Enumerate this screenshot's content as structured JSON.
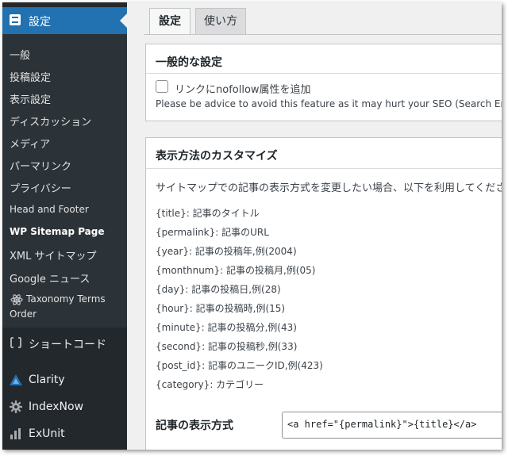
{
  "sidebar": {
    "current": {
      "label": "設定",
      "icon": "settings-icon"
    },
    "items": [
      {
        "label": "一般"
      },
      {
        "label": "投稿設定"
      },
      {
        "label": "表示設定"
      },
      {
        "label": "ディスカッション"
      },
      {
        "label": "メディア"
      },
      {
        "label": "パーマリンク"
      },
      {
        "label": "プライバシー"
      },
      {
        "label": "Head and Footer"
      },
      {
        "label": "WP Sitemap Page"
      },
      {
        "label": "XML サイトマップ"
      },
      {
        "label": "Google ニュース"
      },
      {
        "label": "Taxonomy Terms",
        "label2": "Order"
      }
    ],
    "menus": [
      {
        "label": "ショートコード",
        "icon": "shortcode-icon"
      },
      {
        "label": "Clarity",
        "icon": "clarity-icon"
      },
      {
        "label": "IndexNow",
        "icon": "indexnow-icon"
      },
      {
        "label": "ExUnit",
        "icon": "exunit-icon"
      }
    ]
  },
  "tabs": [
    {
      "label": "設定"
    },
    {
      "label": "使い方"
    }
  ],
  "general": {
    "title": "一般的な設定",
    "nofollow_label": "リンクにnofollow属性を追加",
    "nofollow_help": "Please be advice to avoid this feature as it may hurt your SEO (Search Engine"
  },
  "customize": {
    "title": "表示方法のカスタマイズ",
    "intro": "サイトマップでの記事の表示方式を変更したい場合、以下を利用してくださ",
    "tags": [
      {
        "tag": "{title}",
        "desc": ": 記事のタイトル"
      },
      {
        "tag": "{permalink}",
        "desc": ": 記事のURL"
      },
      {
        "tag": "{year}",
        "desc": ": 記事の投稿年,例(2004)"
      },
      {
        "tag": "{monthnum}",
        "desc": ": 記事の投稿月,例(05)"
      },
      {
        "tag": "{day}",
        "desc": ": 記事の投稿日,例(28)"
      },
      {
        "tag": "{hour}",
        "desc": ": 記事の投稿時,例(15)"
      },
      {
        "tag": "{minute}",
        "desc": ": 記事の投稿分,例(43)"
      },
      {
        "tag": "{second}",
        "desc": ": 記事の投稿秒,例(33)"
      },
      {
        "tag": "{post_id}",
        "desc": ": 記事のユニークID,例(423)"
      },
      {
        "tag": "{category}",
        "desc": ": カテゴリー"
      }
    ],
    "format_label": "記事の表示方式",
    "format_value": "<a href=\"{permalink}\">{title}</a>"
  },
  "colors": {
    "sidebar_bg": "#23282d",
    "submenu_bg": "#2c3338",
    "accent": "#2271b1",
    "page_bg": "#f0f0f1"
  }
}
